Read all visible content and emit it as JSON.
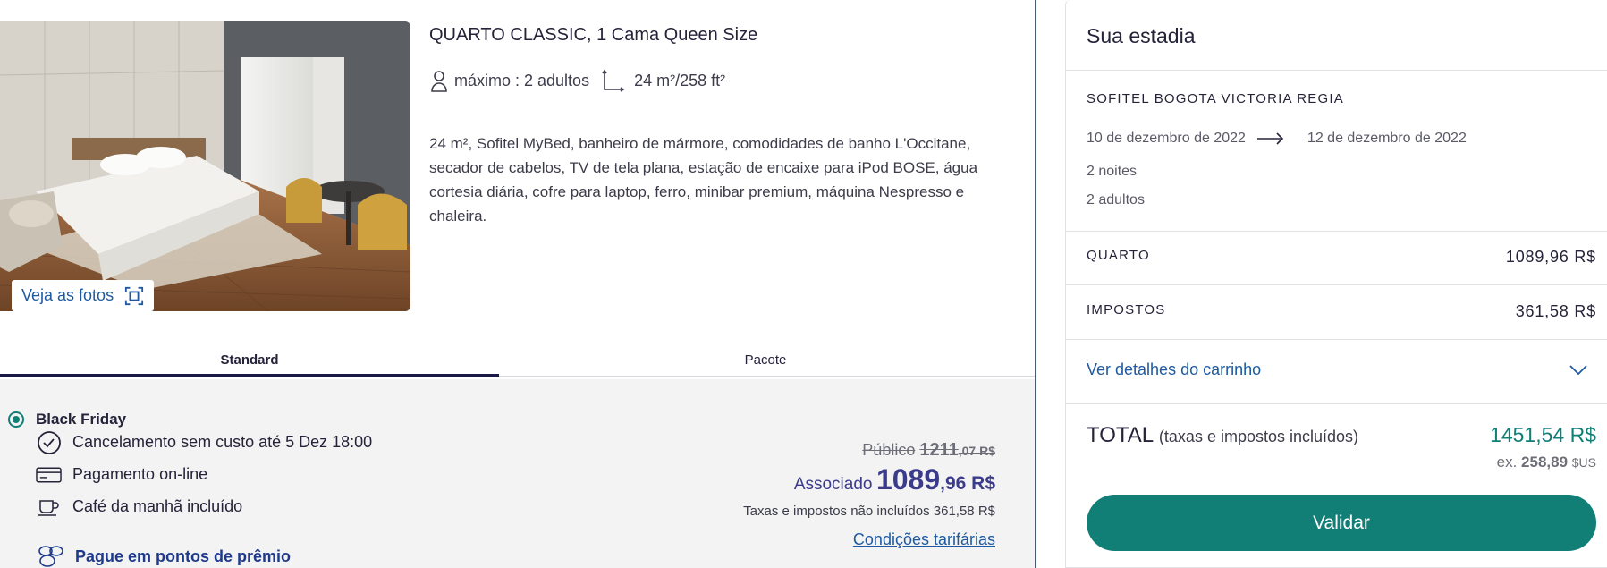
{
  "room": {
    "title": "QUARTO CLASSIC, 1 Cama Queen Size",
    "capacity": "máximo : 2 adultos",
    "size": "24 m²/258 ft²",
    "description": "24 m², Sofitel MyBed, banheiro de mármore, comodidades de banho L'Occitane, secador de cabelos, TV de tela plana, estação de encaixe para iPod BOSE, água cortesia diária, cofre para laptop, ferro, minibar premium, máquina Nespresso e chaleira.",
    "photos_button": "Veja as fotos"
  },
  "tabs": [
    {
      "label": "Standard",
      "active": true
    },
    {
      "label": "Pacote",
      "active": false
    }
  ],
  "rate": {
    "name": "Black Friday",
    "features": [
      {
        "icon": "clock-icon",
        "label": "Cancelamento sem custo até 5 Dez 18:00"
      },
      {
        "icon": "credit-card-icon",
        "label": "Pagamento on-line"
      },
      {
        "icon": "coffee-cup-icon",
        "label": "Café da manhã incluído"
      }
    ],
    "points_link": "Pague em pontos de prêmio",
    "public_label": "Público",
    "public_price_int": "1211",
    "public_price_dec": ",07 R$",
    "member_label": "Associado",
    "member_price_int": "1089",
    "member_price_dec": ",96 R$",
    "tax_note": "Taxas e impostos não incluídos 361,58 R$",
    "conditions_link": "Condições tarifárias"
  },
  "summary": {
    "title": "Sua estadia",
    "hotel": "SOFITEL BOGOTA VICTORIA REGIA",
    "check_in": "10 de dezembro de 2022",
    "check_out": "12 de dezembro de 2022",
    "nights": "2 noites",
    "adults": "2 adultos",
    "room_label": "QUARTO",
    "room_value": "1089,96 R$",
    "tax_label": "IMPOSTOS",
    "tax_value": "361,58 R$",
    "cart_link": "Ver detalhes do carrinho",
    "total_label": "TOTAL",
    "total_sub": "(taxas e impostos incluídos)",
    "total_value": "1451,54 R$",
    "total_usd_prefix": "ex.",
    "total_usd_value": "258,89",
    "total_usd_currency": "$US",
    "validate_button": "Validar"
  },
  "colors": {
    "accent_teal": "#127f77",
    "link_blue": "#1f5aa0",
    "member_price": "#3b3b8c",
    "tab_underline": "#1b1a46"
  }
}
